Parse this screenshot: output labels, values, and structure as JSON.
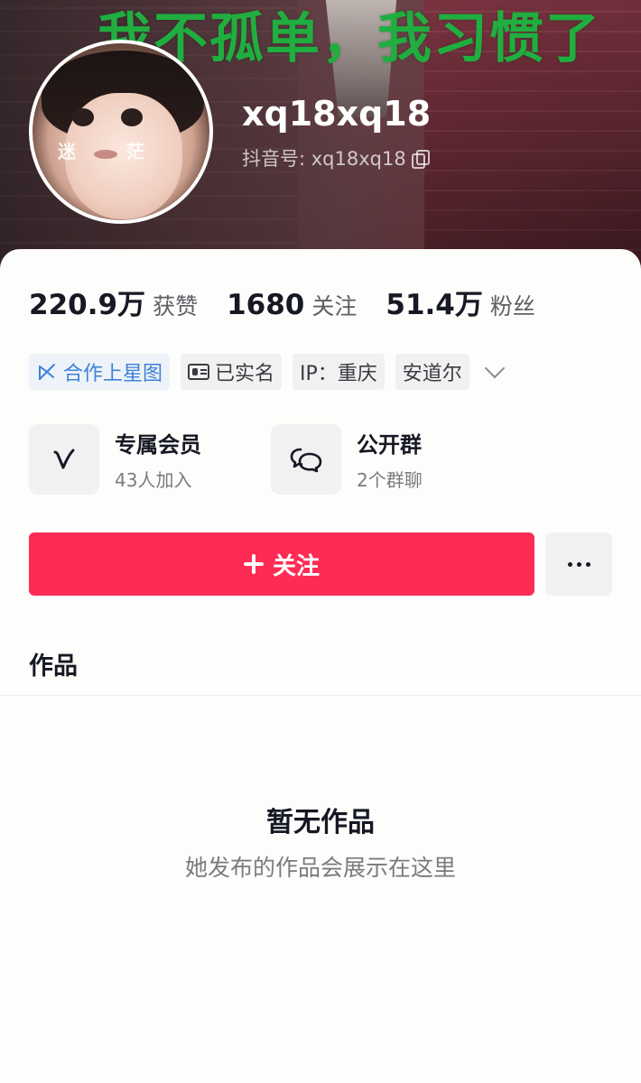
{
  "cover": {
    "slogan": "我不孤单，我习惯了"
  },
  "profile": {
    "username": "xq18xq18",
    "douyin_id_label": "抖音号: xq18xq18",
    "avatar_watermark_left": "迷",
    "avatar_watermark_right": "茫"
  },
  "stats": [
    {
      "value": "220.9万",
      "label": "获赞"
    },
    {
      "value": "1680",
      "label": "关注"
    },
    {
      "value": "51.4万",
      "label": "粉丝"
    }
  ],
  "tags": {
    "star": "合作上星图",
    "verified": "已实名",
    "ip": "IP：重庆",
    "name": "安道尔"
  },
  "features": [
    {
      "title": "专属会员",
      "subtitle": "43人加入",
      "icon": "v-icon"
    },
    {
      "title": "公开群",
      "subtitle": "2个群聊",
      "icon": "chat-bubbles-icon"
    }
  ],
  "actions": {
    "follow_label": "关注",
    "more_icon": "more-dots-icon"
  },
  "tabs": {
    "works": "作品"
  },
  "empty": {
    "title": "暂无作品",
    "subtitle": "她发布的作品会展示在这里"
  },
  "colors": {
    "accent": "#fe2c55",
    "slogan_green": "#1fae3f",
    "star_blue": "#3d82d8"
  }
}
